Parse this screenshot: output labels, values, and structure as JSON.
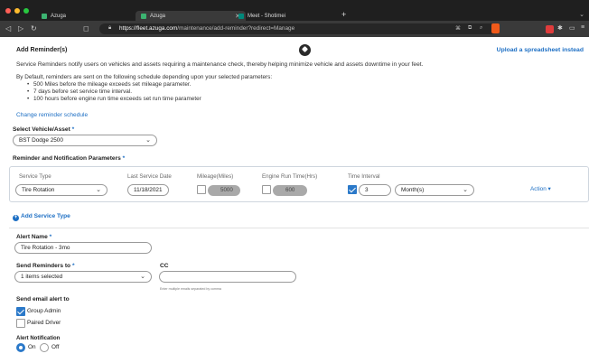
{
  "browser": {
    "tabs": [
      {
        "label": "Azuga",
        "active": false
      },
      {
        "label": "Azuga",
        "active": true
      },
      {
        "label": "Meet - Shotimei",
        "active": false
      }
    ],
    "url_host": "https://fleet.azuga.com",
    "url_path": "/maintenance/add-reminder?redirect=Manage",
    "colors": {
      "close": "#ff5f57",
      "minimize": "#febc2e",
      "maximize": "#28c840"
    },
    "icons": [
      "back-arrow-icon",
      "forward-arrow-icon",
      "reload-icon",
      "bookmark-icon",
      "lock-icon",
      "brave-shield-icon"
    ]
  },
  "page": {
    "title": "Add Reminder(s)",
    "upload_link": "Upload a spreadsheet instead",
    "intro": "Service Reminders notify users on vehicles and assets requiring a maintenance check, thereby helping minimize vehicle and assets downtime in your feet.",
    "default_text": "By Default, reminders are sent on the following schedule depending upon your selected parameters:",
    "bullets": [
      "500 Miles before the mileage exceeds set mileage parameter.",
      "7 days before set service time interval.",
      "100 hours before engine run time exceeds set run time parameter"
    ],
    "change_link": "Change reminder schedule"
  },
  "vehicle": {
    "label": "Select Vehicle/Asset",
    "required_mark": "*",
    "value": "BST Dodge 2500"
  },
  "params": {
    "label": "Reminder and Notification Parameters",
    "required_mark": "*",
    "headers": {
      "service_type": "Service Type",
      "last_service_date": "Last Service Date",
      "mileage": "Mileage(Miles)",
      "engine_run": "Engine Run Time(Hrs)",
      "time_interval": "Time Interval"
    },
    "service_type": "Tire Rotation",
    "last_service_date": "11/18/2021",
    "mileage": "5000",
    "engine_run": "600",
    "time_interval_value": "3",
    "time_interval_unit": "Month(s)",
    "action": "Action ▾"
  },
  "add_service_type": "Add Service Type",
  "alert": {
    "name_label": "Alert Name",
    "required_mark": "*",
    "name_value": "Tire Rotation - 3mo",
    "send_to_label": "Send Reminders to",
    "send_to_value": "1 items selected",
    "cc_label": "CC",
    "cc_hint": "Enter multiple emails separated by comma",
    "email_label": "Send email alert to",
    "email_options": [
      {
        "label": "Group Admin",
        "checked": true
      },
      {
        "label": "Paired Driver",
        "checked": false
      }
    ],
    "notification_label": "Alert Notification",
    "on_label": "On",
    "off_label": "Off",
    "notification_on": true
  }
}
